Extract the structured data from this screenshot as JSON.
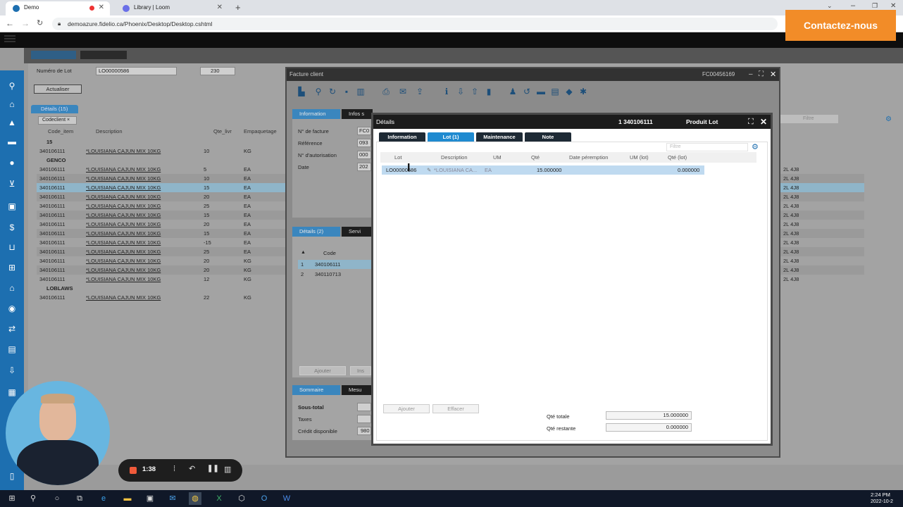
{
  "browser": {
    "tabs": [
      {
        "label": "Demo"
      },
      {
        "label": "Library | Loom"
      }
    ],
    "url": "demoazure.fidelio.ca/Phoenix/Desktop/Desktop.cshtml"
  },
  "overlay": {
    "contact_label": "Contactez-nous"
  },
  "colors": {
    "accent": "#1f8ad0",
    "sidebar": "#1d6fb0",
    "contact": "#f28c28"
  },
  "background": {
    "lot_label": "Numéro de Lot",
    "lot_value": "LO00000586",
    "qty_value": "230",
    "refresh_label": "Actualiser",
    "details_tab": "Détails (15)",
    "filter_chip": "Codeclient",
    "filter_placeholder": "Filtre",
    "columns": [
      "Code_item",
      "Description",
      "Qte_livr",
      "Empaquetage"
    ],
    "groups": [
      {
        "label": "15",
        "rows": [
          {
            "code": "340106111",
            "desc": "*LOUISIANA CAJUN MIX 10KG",
            "qty": "10",
            "pack": "KG",
            "tail": ""
          }
        ]
      },
      {
        "label": "GENCO",
        "rows": [
          {
            "code": "340106111",
            "desc": "*LOUISIANA CAJUN MIX 10KG",
            "qty": "5",
            "pack": "EA",
            "tail": "2L 4J8"
          },
          {
            "code": "340106111",
            "desc": "*LOUISIANA CAJUN MIX 10KG",
            "qty": "10",
            "pack": "EA",
            "tail": "2L 4J8"
          },
          {
            "code": "340106111",
            "desc": "*LOUISIANA CAJUN MIX 10KG",
            "qty": "15",
            "pack": "EA",
            "tail": "2L 4J8"
          },
          {
            "code": "340106111",
            "desc": "*LOUISIANA CAJUN MIX 10KG",
            "qty": "20",
            "pack": "EA",
            "tail": "2L 4J8"
          },
          {
            "code": "340106111",
            "desc": "*LOUISIANA CAJUN MIX 10KG",
            "qty": "25",
            "pack": "EA",
            "tail": "2L 4J8"
          },
          {
            "code": "340106111",
            "desc": "*LOUISIANA CAJUN MIX 10KG",
            "qty": "15",
            "pack": "EA",
            "tail": "2L 4J8"
          },
          {
            "code": "340106111",
            "desc": "*LOUISIANA CAJUN MIX 10KG",
            "qty": "20",
            "pack": "EA",
            "tail": "2L 4J8"
          },
          {
            "code": "340106111",
            "desc": "*LOUISIANA CAJUN MIX 10KG",
            "qty": "15",
            "pack": "EA",
            "tail": "2L 4J8"
          },
          {
            "code": "340106111",
            "desc": "*LOUISIANA CAJUN MIX 10KG",
            "qty": "-15",
            "pack": "EA",
            "tail": "2L 4J8"
          },
          {
            "code": "340106111",
            "desc": "*LOUISIANA CAJUN MIX 10KG",
            "qty": "25",
            "pack": "EA",
            "tail": "2L 4J8"
          },
          {
            "code": "340106111",
            "desc": "*LOUISIANA CAJUN MIX 10KG",
            "qty": "20",
            "pack": "KG",
            "tail": "2L 4J8"
          },
          {
            "code": "340106111",
            "desc": "*LOUISIANA CAJUN MIX 10KG",
            "qty": "20",
            "pack": "KG",
            "tail": "2L 4J8"
          },
          {
            "code": "340106111",
            "desc": "*LOUISIANA CAJUN MIX 10KG",
            "qty": "12",
            "pack": "KG",
            "tail": "2L 4J8"
          }
        ]
      },
      {
        "label": "LOBLAWS",
        "rows": [
          {
            "code": "340106111",
            "desc": "*LOUISIANA CAJUN MIX 10KG",
            "qty": "22",
            "pack": "KG",
            "tail": ""
          }
        ]
      }
    ]
  },
  "invoice": {
    "title": "Facture client",
    "number": "FC00456169",
    "tab_info": "Information",
    "tab_infos": "Infos s",
    "f_invoice": "N° de facture",
    "f_ref": "Référence",
    "f_auth": "N° d'autorisation",
    "f_date": "Date",
    "v_invoice": "FC0",
    "v_ref": "093",
    "v_auth": "000",
    "v_date": "202",
    "details_tab": "Détails (2)",
    "serv_tab": "Servi",
    "code_header": "Code",
    "lines": [
      {
        "n": "1",
        "code": "340106111"
      },
      {
        "n": "2",
        "code": "340110713"
      }
    ],
    "add_label": "Ajouter",
    "ins_label": "Ins",
    "sum_tab": "Sommaire",
    "mes_tab": "Mesu",
    "subtotal_label": "Sous-total",
    "taxes_label": "Taxes",
    "credit_label": "Crédit disponible",
    "credit_value": "980"
  },
  "details": {
    "title": "Détails",
    "code": "1 340106111",
    "product": "Produit Lot",
    "tabs": [
      "Information",
      "Lot (1)",
      "Maintenance",
      "Note"
    ],
    "filter_placeholder": "Filtre",
    "columns": [
      "Lot",
      "Description",
      "UM",
      "Qté",
      "Date péremption",
      "UM (lot)",
      "Qté (lot)"
    ],
    "row": {
      "lot": "LO00000586",
      "desc": "*LOUISIANA CA...",
      "um": "EA",
      "qty": "15.000000",
      "exp": "",
      "um_lot": "",
      "qty_lot": "0.000000"
    },
    "add_label": "Ajouter",
    "clear_label": "Effacer",
    "total_label": "Qté totale",
    "total_value": "15.000000",
    "remain_label": "Qté restante",
    "remain_value": "0.000000"
  },
  "recorder": {
    "time": "1:38"
  },
  "taskbar": {
    "time": "2:24 PM",
    "date": "2022-10-2"
  }
}
